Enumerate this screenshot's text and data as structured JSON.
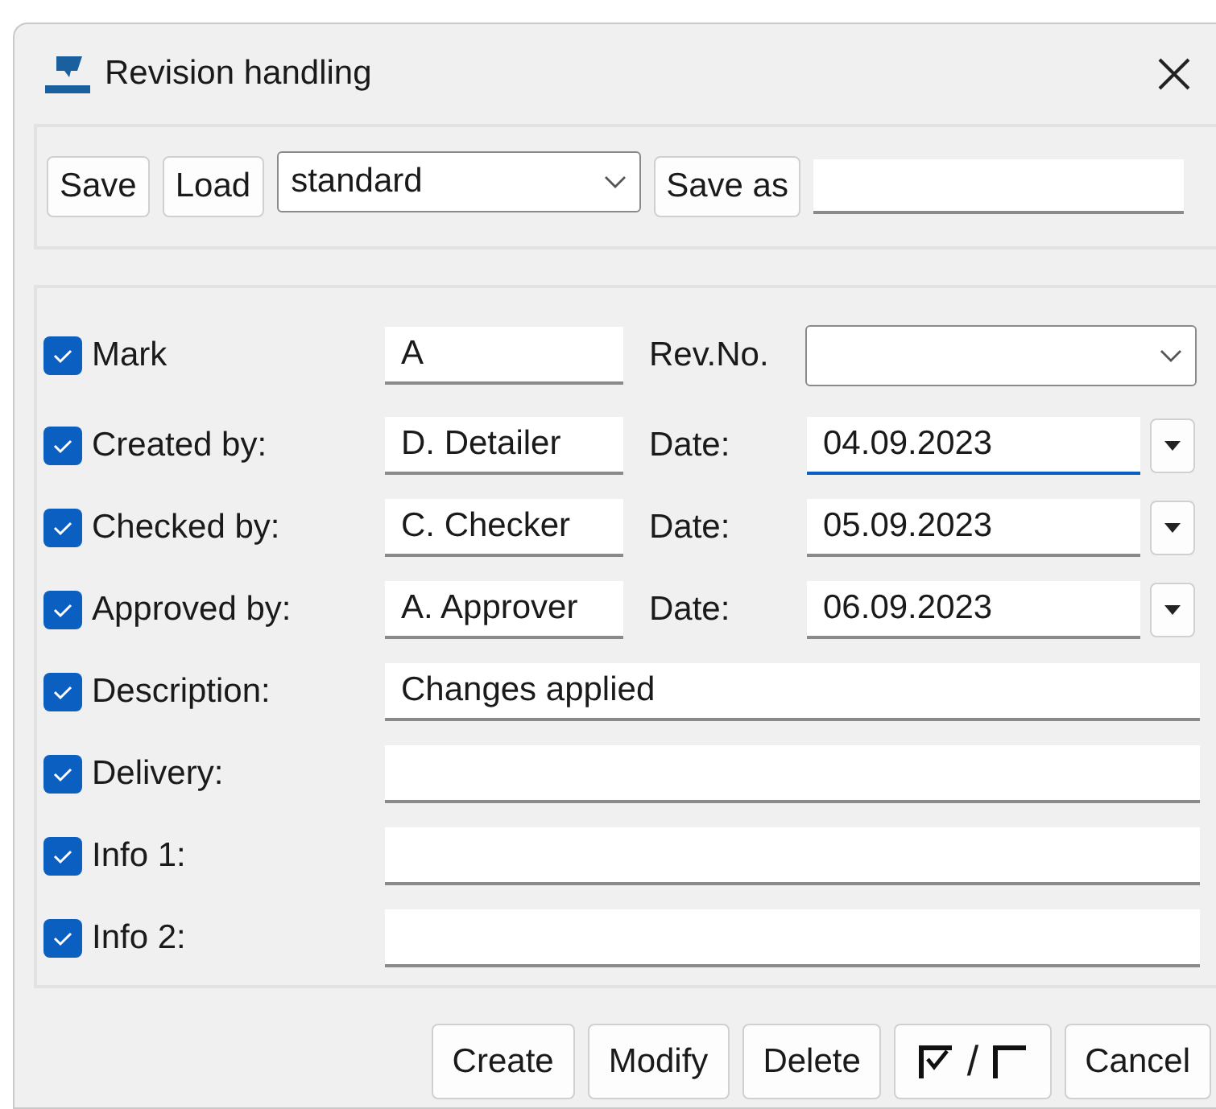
{
  "window": {
    "title": "Revision handling"
  },
  "toolbar": {
    "save": "Save",
    "load": "Load",
    "preset": "standard",
    "save_as": "Save as"
  },
  "rows": [
    {
      "kind": "mark",
      "checked": true,
      "label": "Mark",
      "value": "A",
      "label2": "Rev.No.",
      "value2": ""
    },
    {
      "kind": "person_date",
      "checked": true,
      "label": "Created by:",
      "value": "D. Detailer",
      "label2": "Date:",
      "value2": "04.09.2023",
      "focused": true
    },
    {
      "kind": "person_date",
      "checked": true,
      "label": "Checked by:",
      "value": "C. Checker",
      "label2": "Date:",
      "value2": "05.09.2023",
      "focused": false
    },
    {
      "kind": "person_date",
      "checked": true,
      "label": "Approved by:",
      "value": "A. Approver",
      "label2": "Date:",
      "value2": "06.09.2023",
      "focused": false
    },
    {
      "kind": "text",
      "checked": true,
      "label": "Description:",
      "value": "Changes applied"
    },
    {
      "kind": "text",
      "checked": true,
      "label": "Delivery:",
      "value": ""
    },
    {
      "kind": "text",
      "checked": true,
      "label": "Info 1:",
      "value": ""
    },
    {
      "kind": "text",
      "checked": true,
      "label": "Info 2:",
      "value": ""
    }
  ],
  "buttons": [
    {
      "kind": "text",
      "label": "Create"
    },
    {
      "kind": "text",
      "label": "Modify"
    },
    {
      "kind": "text",
      "label": "Delete"
    },
    {
      "kind": "toggle",
      "label": "/"
    },
    {
      "kind": "text",
      "label": "Cancel"
    }
  ]
}
